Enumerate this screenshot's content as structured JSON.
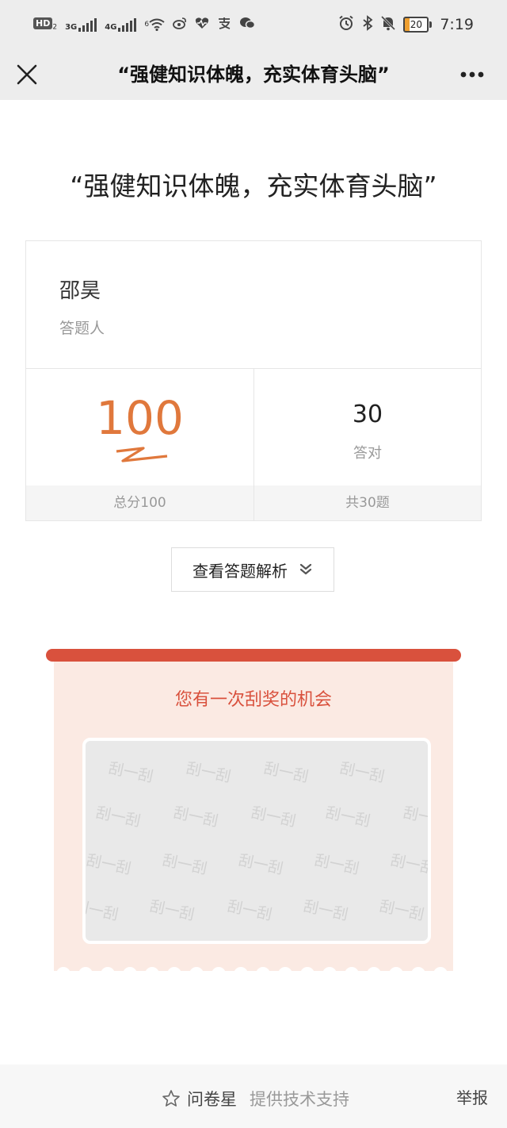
{
  "status_bar": {
    "hd_label": "HD",
    "hd_sub": "2",
    "net1": "3G",
    "net2": "4G",
    "wifi_sub": "6",
    "battery": "20",
    "time": "7:19"
  },
  "nav": {
    "title": "“强健知识体魄，充实体育头脑”",
    "close_icon": "close-icon",
    "more_icon": "more-icon"
  },
  "quiz": {
    "title": "“强健知识体魄，充实体育头脑”",
    "respondent_name": "邵昊",
    "respondent_label": "答题人",
    "score": "100",
    "score_total_label": "总分100",
    "correct_count": "30",
    "correct_label": "答对",
    "total_questions_label": "共30题"
  },
  "actions": {
    "view_analysis_label": "查看答题解析"
  },
  "scratch_card": {
    "title": "您有一次刮奖的机会",
    "watermark_text": "刮一刮"
  },
  "footer": {
    "brand_name": "问卷星",
    "support_text": "提供技术支持",
    "report_label": "举报"
  },
  "colors": {
    "accent": "#e0783c",
    "scratch_red": "#d9513d",
    "scratch_bg": "#fbeae3"
  }
}
